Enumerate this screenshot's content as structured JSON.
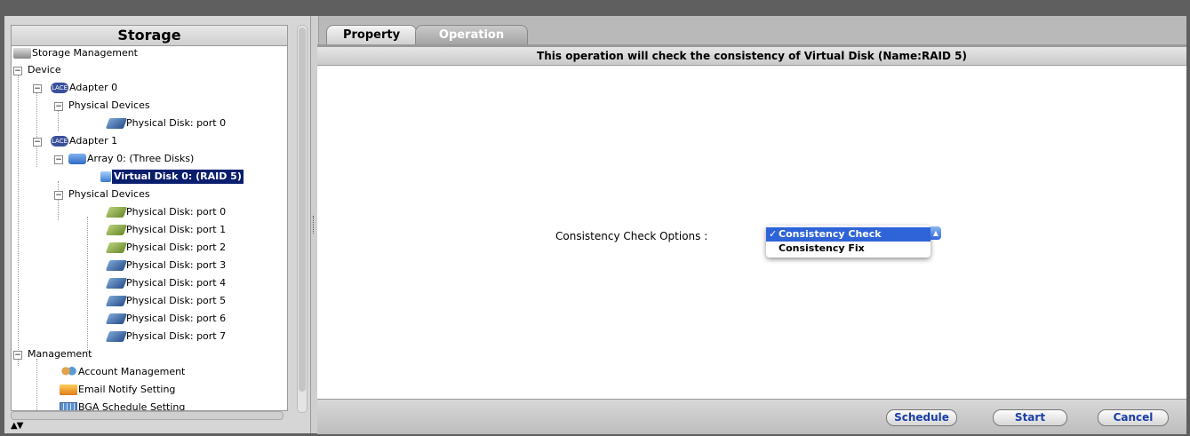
{
  "left_panel": {
    "title": "Storage",
    "tree": {
      "root": "Storage Management",
      "device": "Device",
      "adapter0": "Adapter 0",
      "adapter0_phys": "Physical Devices",
      "adapter0_disk0": "Physical Disk: port 0",
      "adapter1": "Adapter 1",
      "array0": "Array 0: (Three Disks)",
      "vdisk0": "Virtual Disk 0: (RAID 5)",
      "adapter1_phys": "Physical Devices",
      "disks": [
        "Physical Disk: port 0",
        "Physical Disk: port 1",
        "Physical Disk: port 2",
        "Physical Disk: port 3",
        "Physical Disk: port 4",
        "Physical Disk: port 5",
        "Physical Disk: port 6",
        "Physical Disk: port 7"
      ],
      "management": "Management",
      "account": "Account Management",
      "email": "Email Notify Setting",
      "bga": "BGA Schedule Setting"
    },
    "adapter_icon_text": "LACE"
  },
  "tabs": {
    "property": "Property",
    "operation": "Operation"
  },
  "header_text": "This operation will check the consistency of Virtual Disk (Name:RAID 5)",
  "options": {
    "label": "Consistency Check Options :",
    "items": [
      "Consistency Check",
      "Consistency Fix"
    ],
    "selected": "Consistency Check",
    "check_mark": "✓"
  },
  "buttons": {
    "schedule": "Schedule",
    "start": "Start",
    "cancel": "Cancel"
  },
  "colors": {
    "selection": "#0a1e6e",
    "menu_highlight": "#2f64d9",
    "button_text": "#1c3fa8"
  }
}
